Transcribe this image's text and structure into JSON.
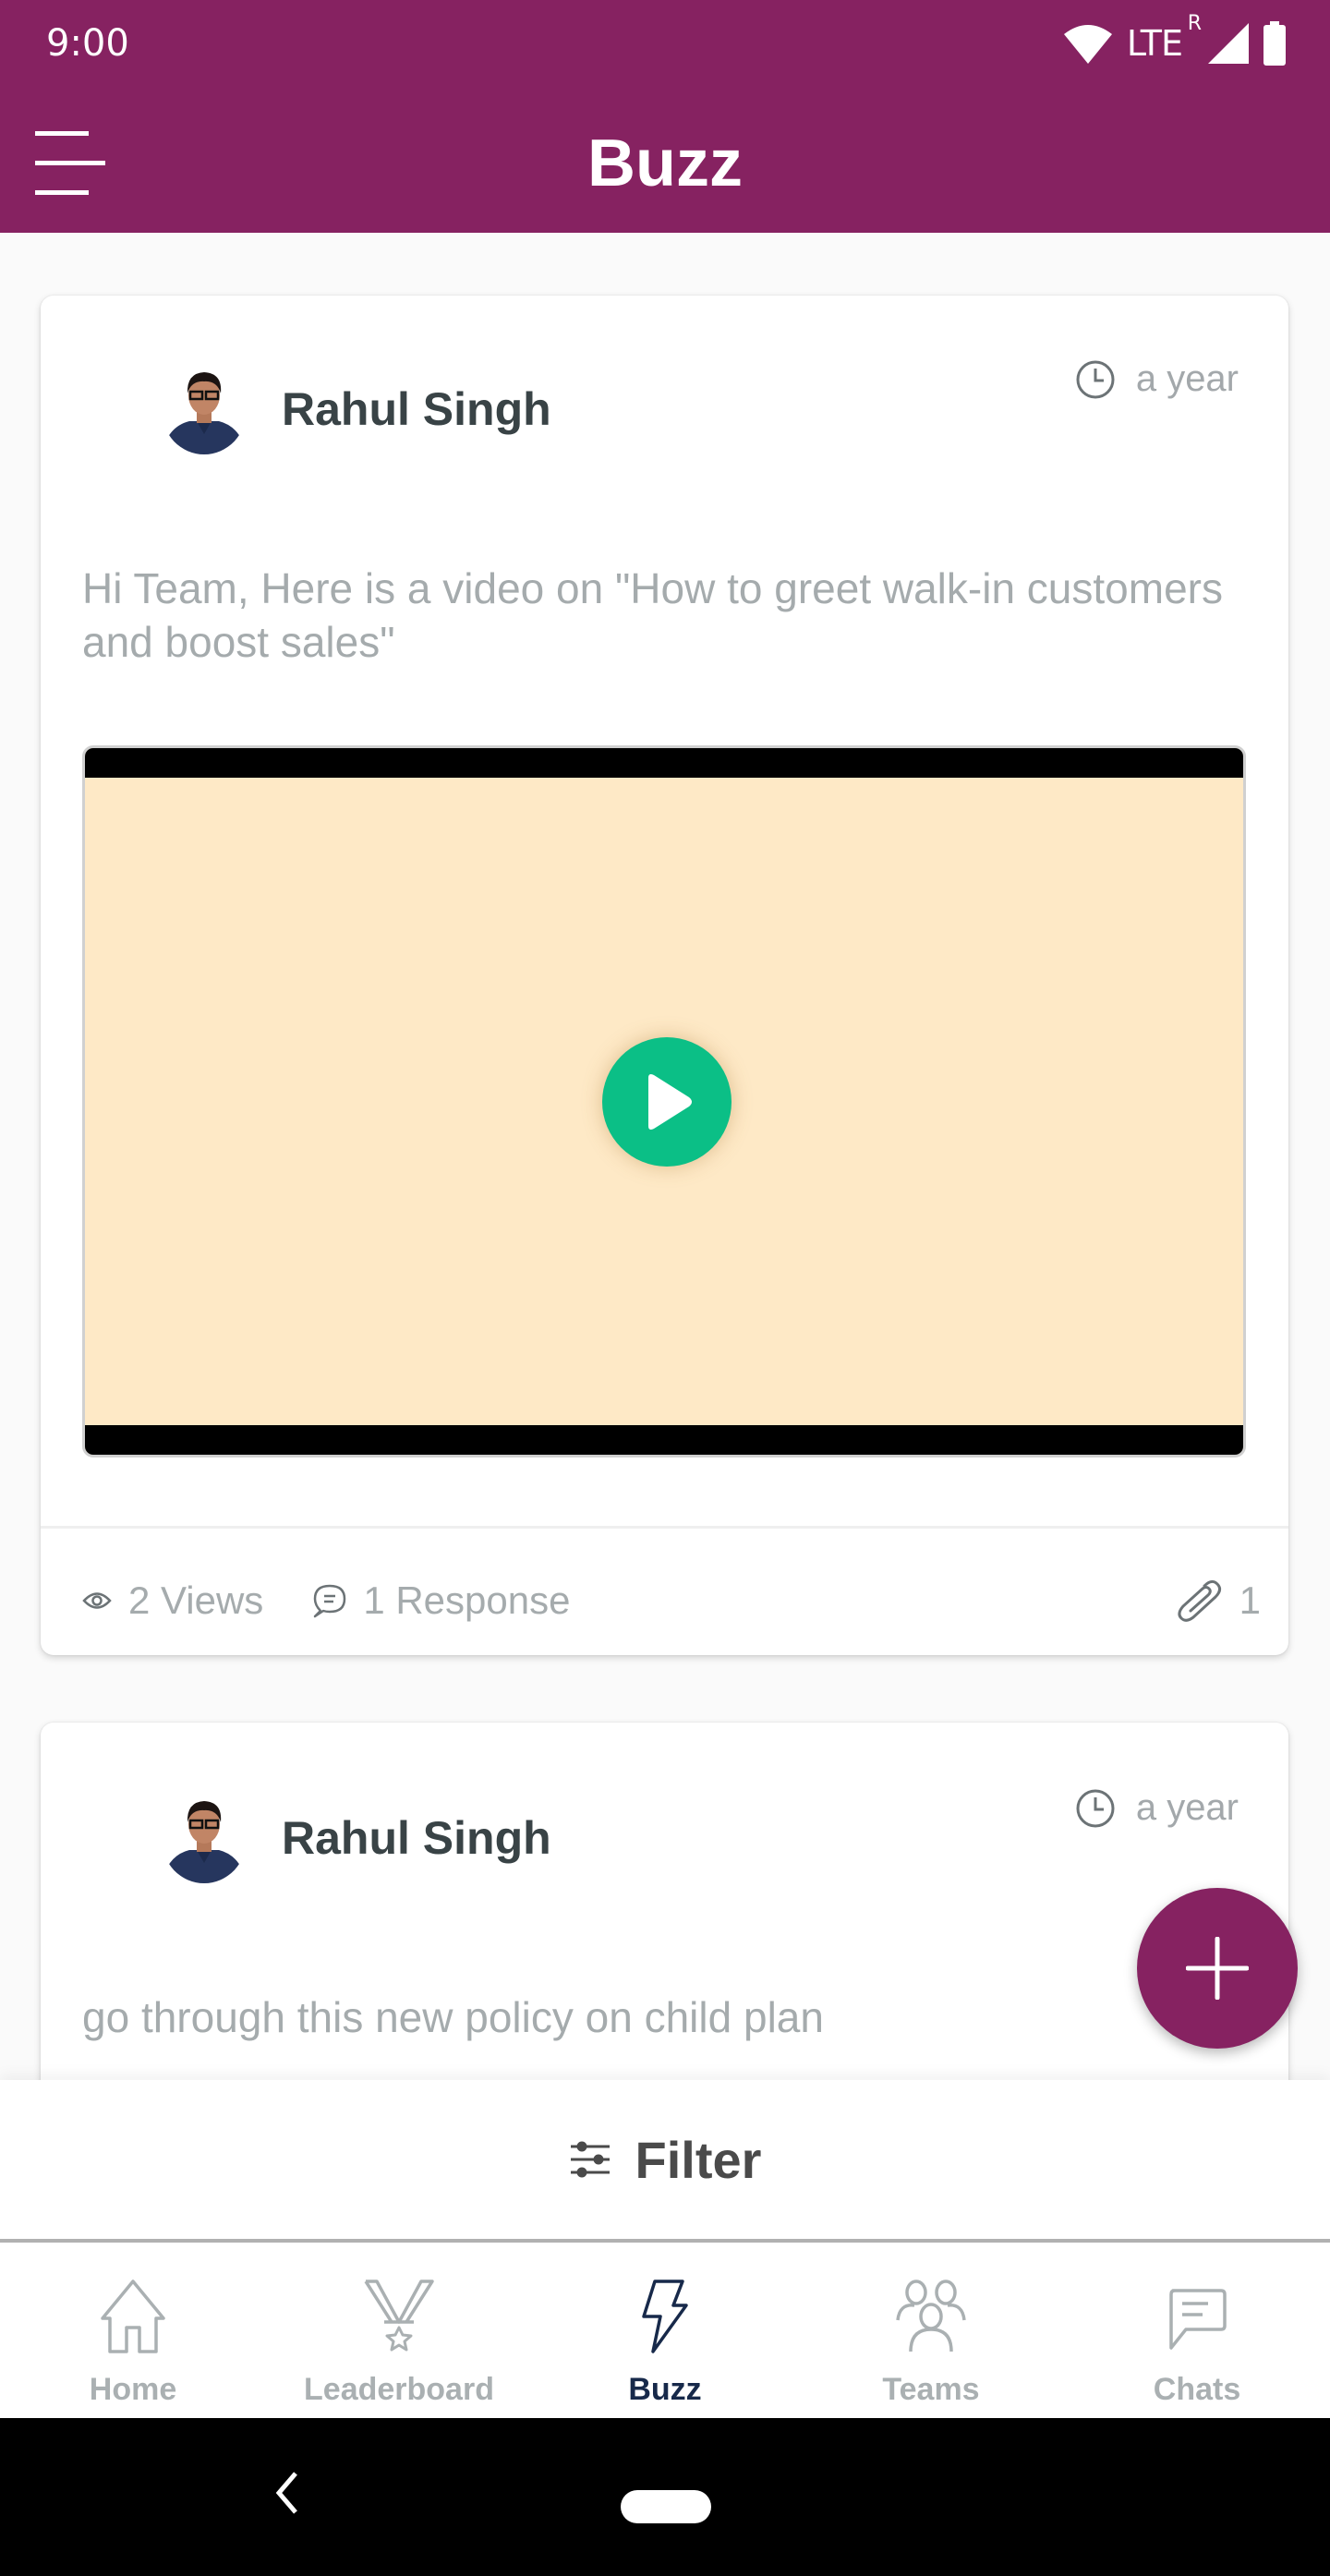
{
  "status_bar": {
    "time": "9:00",
    "network": "LTE",
    "roaming": "R",
    "icons": [
      "wifi-icon",
      "signal-icon",
      "battery-icon"
    ]
  },
  "app_bar": {
    "title": "Buzz",
    "menu_icon": "hamburger-menu-icon",
    "color": "#862261"
  },
  "posts": [
    {
      "author": "Rahul Singh",
      "time": "a year",
      "text": "Hi Team, Here is a video on \"How to greet walk-in customers and boost sales\"",
      "has_video": true,
      "views": "2 Views",
      "responses": "1 Response",
      "attachments": "1"
    },
    {
      "author": "Rahul Singh",
      "time": "a year",
      "text": "go through this  new policy on child plan"
    }
  ],
  "fab": {
    "icon": "plus-icon",
    "color": "#862261"
  },
  "filter": {
    "label": "Filter",
    "icon": "sliders-icon"
  },
  "bottom_nav": {
    "active": "Buzz",
    "active_color": "#17294a",
    "items": [
      {
        "label": "Home",
        "icon": "home-icon"
      },
      {
        "label": "Leaderboard",
        "icon": "medal-icon"
      },
      {
        "label": "Buzz",
        "icon": "lightning-icon"
      },
      {
        "label": "Teams",
        "icon": "team-icon"
      },
      {
        "label": "Chats",
        "icon": "chat-icon"
      }
    ]
  },
  "colors": {
    "primary": "#862261",
    "play_button": "#0bbf86",
    "video_placeholder": "#fee9c6",
    "author_text": "#394346",
    "muted_text": "#a5abad"
  }
}
